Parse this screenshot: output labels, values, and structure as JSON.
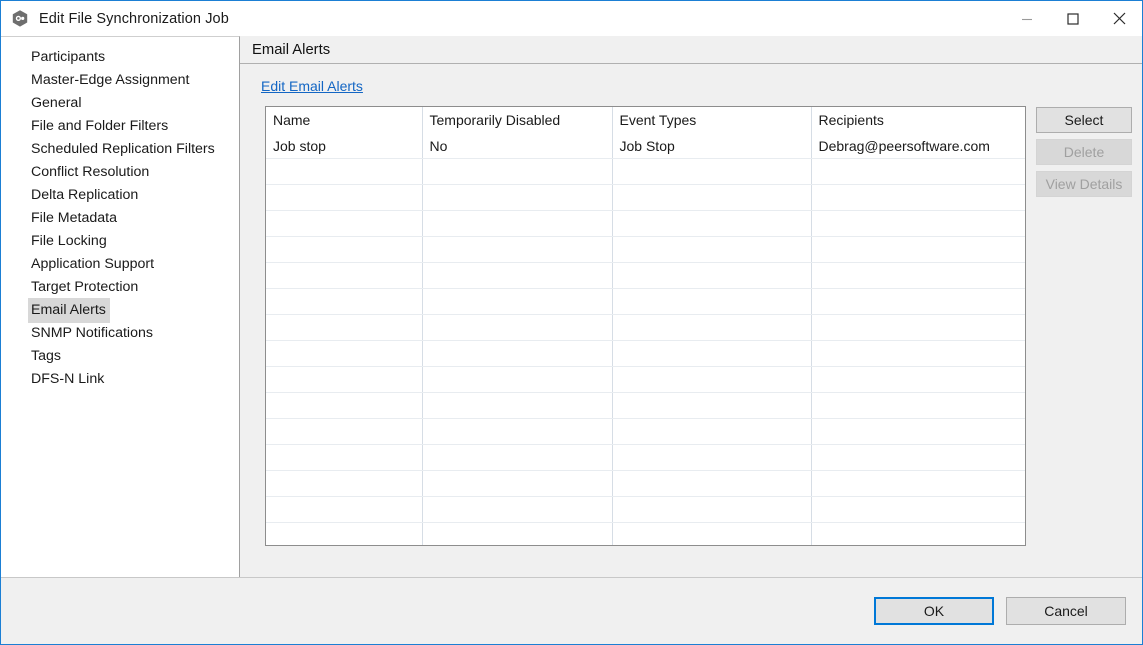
{
  "window": {
    "title": "Edit File Synchronization Job",
    "icon": "app-hexagon-icon",
    "controls": {
      "minimize": "minimize-icon",
      "maximize": "maximize-icon",
      "close": "close-icon"
    },
    "accent_color": "#1b7fd4"
  },
  "sidebar": {
    "items": [
      {
        "label": "Participants",
        "selected": false
      },
      {
        "label": "Master-Edge Assignment",
        "selected": false
      },
      {
        "label": "General",
        "selected": false
      },
      {
        "label": "File and Folder Filters",
        "selected": false
      },
      {
        "label": "Scheduled Replication Filters",
        "selected": false
      },
      {
        "label": "Conflict Resolution",
        "selected": false
      },
      {
        "label": "Delta Replication",
        "selected": false
      },
      {
        "label": "File Metadata",
        "selected": false
      },
      {
        "label": "File Locking",
        "selected": false
      },
      {
        "label": "Application Support",
        "selected": false
      },
      {
        "label": "Target Protection",
        "selected": false
      },
      {
        "label": "Email Alerts",
        "selected": true
      },
      {
        "label": "SNMP Notifications",
        "selected": false
      },
      {
        "label": "Tags",
        "selected": false
      },
      {
        "label": "DFS-N Link",
        "selected": false
      }
    ]
  },
  "content": {
    "header_title": "Email Alerts",
    "edit_link": "Edit Email Alerts",
    "table": {
      "columns": [
        "Name",
        "Temporarily Disabled",
        "Event Types",
        "Recipients"
      ],
      "rows": [
        {
          "name": "Job stop",
          "temporarily_disabled": "No",
          "event_types": "Job Stop",
          "recipients": "Debrag@peersoftware.com"
        }
      ],
      "empty_row_count": 16
    },
    "side_buttons": [
      {
        "label": "Select",
        "enabled": true
      },
      {
        "label": "Delete",
        "enabled": false
      },
      {
        "label": "View Details",
        "enabled": false
      }
    ]
  },
  "footer": {
    "ok_label": "OK",
    "cancel_label": "Cancel"
  }
}
